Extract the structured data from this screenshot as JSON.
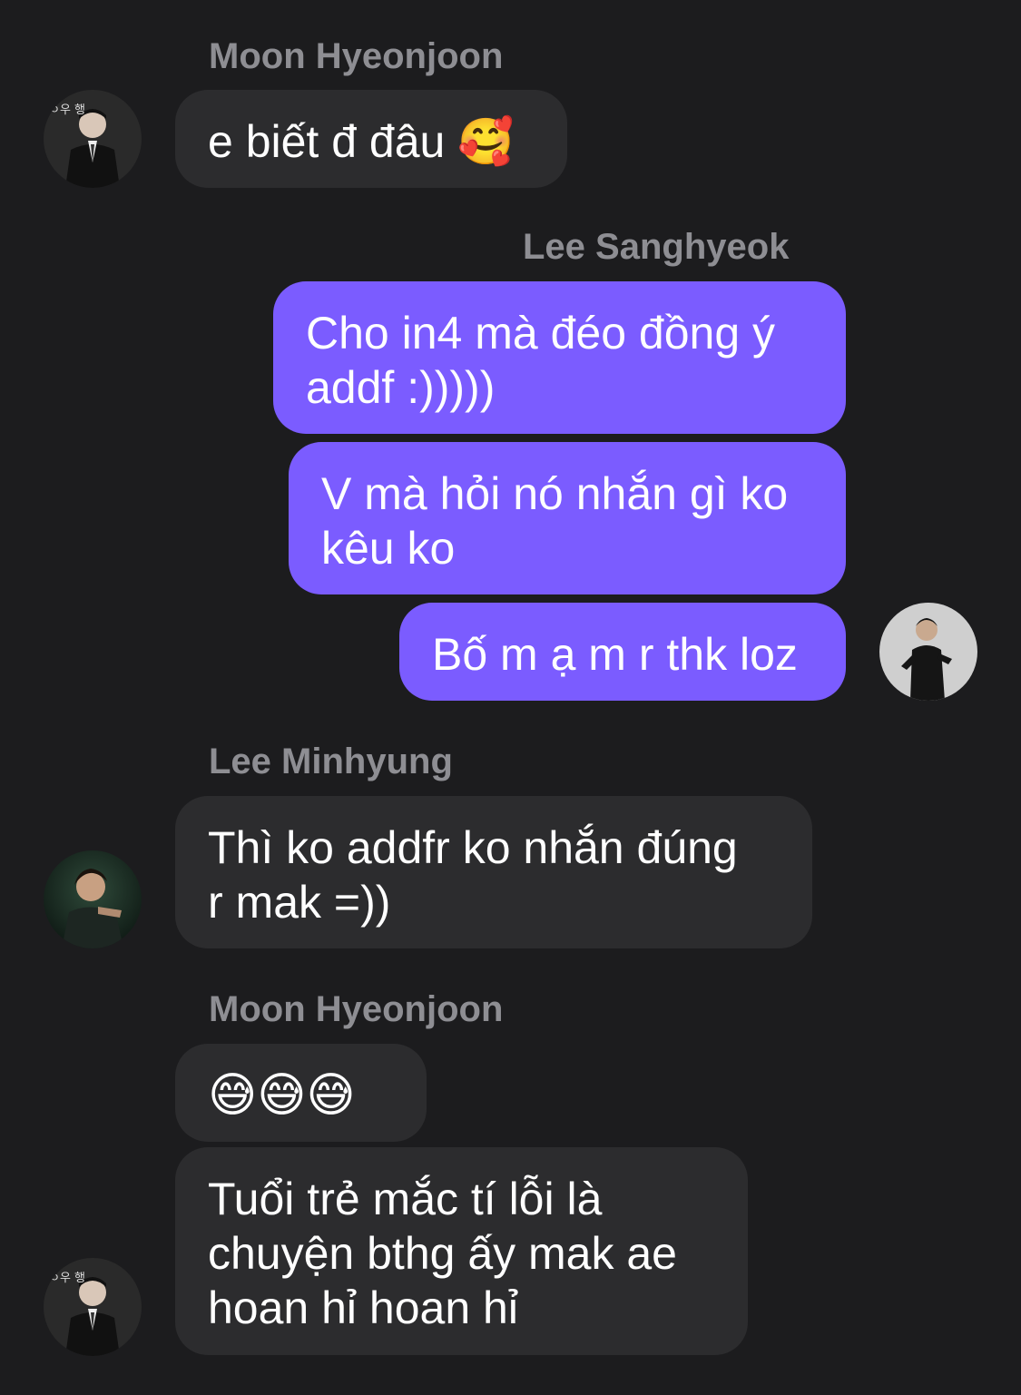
{
  "chat": {
    "messages": [
      {
        "sender": "Moon Hyeonjoon",
        "direction": "incoming",
        "lines": [
          "e biết đ đâu 🥰"
        ]
      },
      {
        "sender": "Lee Sanghyeok",
        "direction": "outgoing",
        "lines": [
          "Cho in4 mà đéo đồng ý",
          "addf :)))))"
        ]
      },
      {
        "sender": "Lee Sanghyeok",
        "direction": "outgoing",
        "lines": [
          "V mà hỏi nó nhắn gì ko",
          "kêu ko"
        ]
      },
      {
        "sender": "Lee Sanghyeok",
        "direction": "outgoing",
        "lines": [
          "Bố m ạ m r thk loz"
        ]
      },
      {
        "sender": "Lee Minhyung",
        "direction": "incoming",
        "lines": [
          "Thì ko addfr ko nhắn đúng",
          "r mak =))"
        ]
      },
      {
        "sender": "Moon Hyeonjoon",
        "direction": "incoming",
        "lines": [
          "😅😅😅"
        ]
      },
      {
        "sender": "Moon Hyeonjoon",
        "direction": "incoming",
        "lines": [
          "Tuổi trẻ mắc tí lỗi là",
          "chuyện bthg ấy mak ae",
          "hoan hỉ hoan hỉ"
        ]
      }
    ],
    "avatar_icons": [
      "avatar-moon-hyeonjoon",
      "avatar-lee-sanghyeok",
      "avatar-lee-minhyung"
    ]
  },
  "colors": {
    "background": "#1c1c1e",
    "incoming_bubble": "#2c2c2e",
    "outgoing_bubble": "#7b5cff",
    "sender_name": "#8e8e93",
    "text": "#ffffff"
  }
}
